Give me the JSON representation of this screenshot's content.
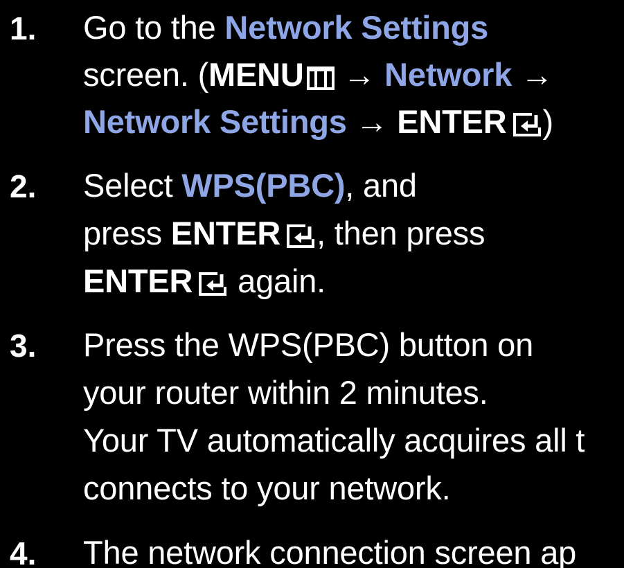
{
  "steps": [
    {
      "number": "1.",
      "line1": {
        "prefix": "Go to the ",
        "highlight": "Network Settings"
      },
      "line2": {
        "prefix": "screen. (",
        "menu_key": "MENU",
        "arrow1": " → ",
        "highlight": "Network",
        "arrow2": " →"
      },
      "line3": {
        "highlight": "Network Settings",
        "arrow": " → ",
        "enter_key": "ENTER",
        "suffix": ")"
      }
    },
    {
      "number": "2.",
      "line1": {
        "prefix": "Select ",
        "highlight": "WPS(PBC)",
        "suffix": ", and"
      },
      "line2": {
        "prefix": "press ",
        "enter_key": "ENTER",
        "suffix": ", then press"
      },
      "line3": {
        "enter_key": "ENTER",
        "suffix": " again."
      }
    },
    {
      "number": "3.",
      "lines": [
        "Press the WPS(PBC) button on",
        "your router within 2 minutes.",
        "Your TV automatically acquires all t",
        "connects to your network."
      ]
    },
    {
      "number": "4.",
      "lines": [
        "The network connection screen ap"
      ]
    }
  ],
  "icons": {
    "menu": "menu-grid-icon",
    "enter": "enter-key-icon"
  },
  "colors": {
    "background": "#000000",
    "text": "#ffffff",
    "highlight": "#8ea6e6"
  }
}
